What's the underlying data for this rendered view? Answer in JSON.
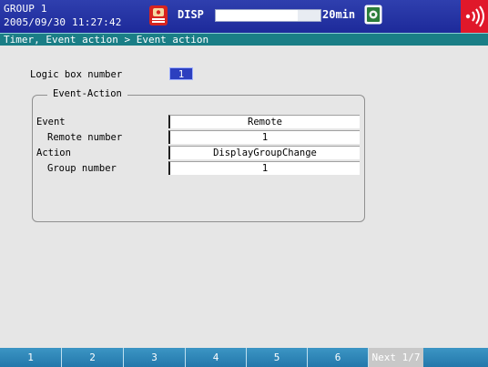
{
  "status_bar": {
    "group_name": "GROUP 1",
    "datetime": "2005/09/30 11:27:42",
    "mode_label": "DISP",
    "rate_label": "20min",
    "memory_fill_fraction": 0.78,
    "icons": [
      "alarm-icon",
      "media-icon",
      "communication-icon"
    ]
  },
  "breadcrumb": "Timer, Event action > Event action",
  "form": {
    "logic_box_label": "Logic box number",
    "logic_box_value": "1",
    "group_title": "Event-Action",
    "rows": [
      {
        "label": "Event",
        "value": "Remote"
      },
      {
        "label": "Remote number",
        "value": "1"
      },
      {
        "label": "Action",
        "value": "DisplayGroupChange"
      },
      {
        "label": "Group number",
        "value": "1"
      }
    ]
  },
  "softkeys": {
    "keys": [
      "1",
      "2",
      "3",
      "4",
      "5",
      "6"
    ],
    "next_label": "Next 1/7"
  },
  "colors": {
    "title_bar": "#1d2a9a",
    "breadcrumb_bar": "#1a7e86",
    "panel_bg": "#e6e6e6",
    "softkey_bar": "#2378ab",
    "selected_value": "#2c3fbf",
    "comm_icon": "#e0182a"
  }
}
